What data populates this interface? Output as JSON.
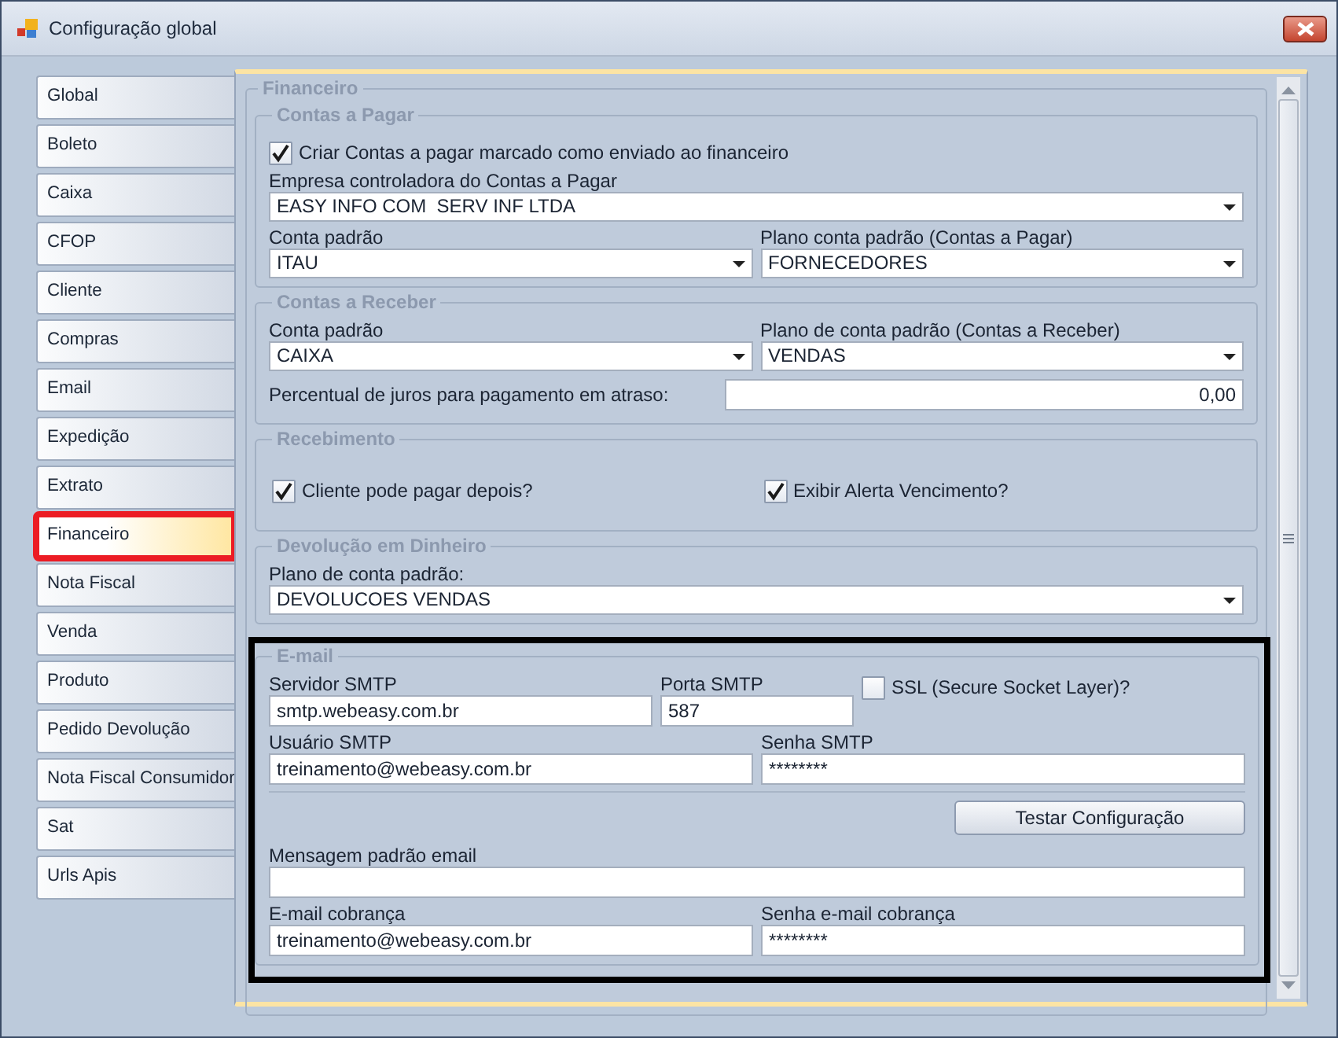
{
  "window": {
    "title": "Configuração global"
  },
  "sidebar": {
    "items": [
      {
        "label": "Global",
        "selected": false,
        "highlighted": false
      },
      {
        "label": "Boleto",
        "selected": false,
        "highlighted": false
      },
      {
        "label": "Caixa",
        "selected": false,
        "highlighted": false
      },
      {
        "label": "CFOP",
        "selected": false,
        "highlighted": false
      },
      {
        "label": "Cliente",
        "selected": false,
        "highlighted": false
      },
      {
        "label": "Compras",
        "selected": false,
        "highlighted": false
      },
      {
        "label": "Email",
        "selected": false,
        "highlighted": false
      },
      {
        "label": "Expedição",
        "selected": false,
        "highlighted": false
      },
      {
        "label": "Extrato",
        "selected": false,
        "highlighted": false
      },
      {
        "label": "Financeiro",
        "selected": true,
        "highlighted": true
      },
      {
        "label": "Nota Fiscal",
        "selected": false,
        "highlighted": false
      },
      {
        "label": "Venda",
        "selected": false,
        "highlighted": false
      },
      {
        "label": "Produto",
        "selected": false,
        "highlighted": false
      },
      {
        "label": "Pedido Devolução",
        "selected": false,
        "highlighted": false
      },
      {
        "label": "Nota Fiscal Consumidor",
        "selected": false,
        "highlighted": false
      },
      {
        "label": "Sat",
        "selected": false,
        "highlighted": false
      },
      {
        "label": "Urls Apis",
        "selected": false,
        "highlighted": false
      }
    ]
  },
  "panel": {
    "title": "Financeiro",
    "groups": [
      {
        "title": "Contas a Pagar",
        "highlighted": false,
        "rows": [
          {
            "kind": "check",
            "items": [
              {
                "label": "Criar Contas a pagar marcado como enviado ao financeiro",
                "kind": "checkbox",
                "checked": true
              }
            ]
          },
          {
            "kind": "fields",
            "items": [
              {
                "label": "Empresa controladora do Contas a Pagar",
                "kind": "dropdown",
                "value": "EASY INFO COM  SERV INF LTDA"
              }
            ]
          },
          {
            "kind": "fields",
            "items": [
              {
                "label": "Conta padrão",
                "kind": "dropdown",
                "value": "ITAU"
              },
              {
                "label": "Plano conta padrão (Contas a Pagar)",
                "kind": "dropdown",
                "value": "FORNECEDORES"
              }
            ]
          }
        ]
      },
      {
        "title": "Contas a Receber",
        "highlighted": false,
        "rows": [
          {
            "kind": "fields",
            "items": [
              {
                "label": "Conta padrão",
                "kind": "dropdown",
                "value": "CAIXA"
              },
              {
                "label": "Plano de conta padrão (Contas a Receber)",
                "kind": "dropdown",
                "value": "VENDAS"
              }
            ]
          },
          {
            "kind": "inline",
            "items": [
              {
                "label": "Percentual de juros para pagamento em atraso:",
                "kind": "text",
                "value": "0,00"
              }
            ]
          }
        ]
      },
      {
        "title": "Recebimento",
        "highlighted": false,
        "rows": [
          {
            "kind": "check",
            "items": [
              {
                "label": "Cliente pode pagar depois?",
                "kind": "checkbox",
                "checked": true
              },
              {
                "label": "Exibir Alerta Vencimento?",
                "kind": "checkbox",
                "checked": true
              }
            ]
          }
        ]
      },
      {
        "title": "Devolução em Dinheiro",
        "highlighted": false,
        "rows": [
          {
            "kind": "fields",
            "items": [
              {
                "label": "Plano de conta padrão:",
                "kind": "dropdown",
                "value": "DEVOLUCOES VENDAS"
              }
            ]
          }
        ]
      },
      {
        "title": "E-mail",
        "highlighted": true,
        "rows": [
          {
            "kind": "smtp",
            "items": [
              {
                "label": "Servidor SMTP",
                "kind": "text",
                "value": "smtp.webeasy.com.br"
              },
              {
                "label": "Porta SMTP",
                "kind": "text",
                "value": "587"
              },
              {
                "label": "SSL (Secure Socket Layer)?",
                "kind": "checkbox",
                "checked": false
              }
            ]
          },
          {
            "kind": "fields",
            "items": [
              {
                "label": "Usuário SMTP",
                "kind": "text",
                "value": "treinamento@webeasy.com.br"
              },
              {
                "label": "Senha SMTP",
                "kind": "text",
                "value": "********"
              }
            ]
          },
          {
            "kind": "button",
            "items": [
              {
                "label": "Testar Configuração"
              }
            ]
          },
          {
            "kind": "fields",
            "items": [
              {
                "label": "Mensagem padrão email",
                "kind": "text"
              }
            ]
          },
          {
            "kind": "fields",
            "items": [
              {
                "label": "E-mail cobrança",
                "kind": "text",
                "value": "treinamento@webeasy.com.br"
              },
              {
                "label": "Senha e-mail cobrança",
                "kind": "text",
                "value": "********"
              }
            ]
          }
        ]
      }
    ]
  }
}
